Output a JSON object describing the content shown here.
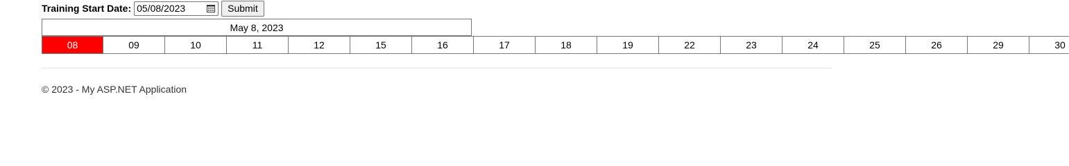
{
  "form": {
    "label": "Training Start Date:",
    "date_value": "05/08/2023",
    "submit_label": "Submit",
    "calendar_icon": "calendar-icon"
  },
  "calendar": {
    "month_header": "May 8, 2023",
    "selected_color": "#ff0000",
    "days": [
      {
        "label": "08",
        "selected": true
      },
      {
        "label": "09",
        "selected": false
      },
      {
        "label": "10",
        "selected": false
      },
      {
        "label": "11",
        "selected": false
      },
      {
        "label": "12",
        "selected": false
      },
      {
        "label": "15",
        "selected": false
      },
      {
        "label": "16",
        "selected": false
      },
      {
        "label": "17",
        "selected": false
      },
      {
        "label": "18",
        "selected": false
      },
      {
        "label": "19",
        "selected": false
      },
      {
        "label": "22",
        "selected": false
      },
      {
        "label": "23",
        "selected": false
      },
      {
        "label": "24",
        "selected": false
      },
      {
        "label": "25",
        "selected": false
      },
      {
        "label": "26",
        "selected": false
      },
      {
        "label": "29",
        "selected": false
      },
      {
        "label": "30",
        "selected": false
      }
    ]
  },
  "footer": {
    "text": "© 2023 - My ASP.NET Application"
  }
}
